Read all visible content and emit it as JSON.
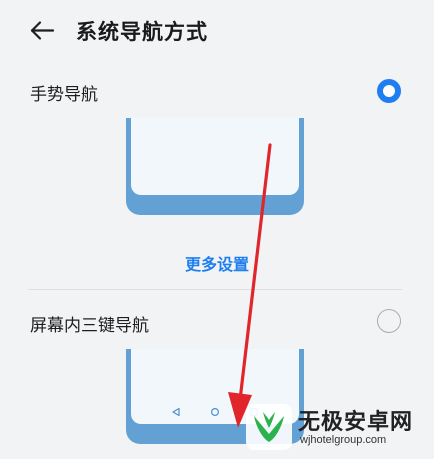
{
  "header": {
    "title": "系统导航方式",
    "back_icon": "arrow-left-icon"
  },
  "options": [
    {
      "label": "手势导航",
      "selected": true
    },
    {
      "label": "屏幕内三键导航",
      "selected": false
    }
  ],
  "more_settings_label": "更多设置",
  "three_key_icons": [
    "triangle-back-icon",
    "circle-home-icon",
    "square-recent-icon"
  ],
  "colors": {
    "accent": "#1f7ff0",
    "phone_frame": "#63a1d4",
    "phone_screen": "#f1f7fb",
    "background": "#f1f3f5",
    "annotation_arrow": "#e0262a",
    "watermark_logo": "#2bb24c"
  },
  "watermark": {
    "title": "无极安卓网",
    "url": "wjhotelgroup.com"
  }
}
